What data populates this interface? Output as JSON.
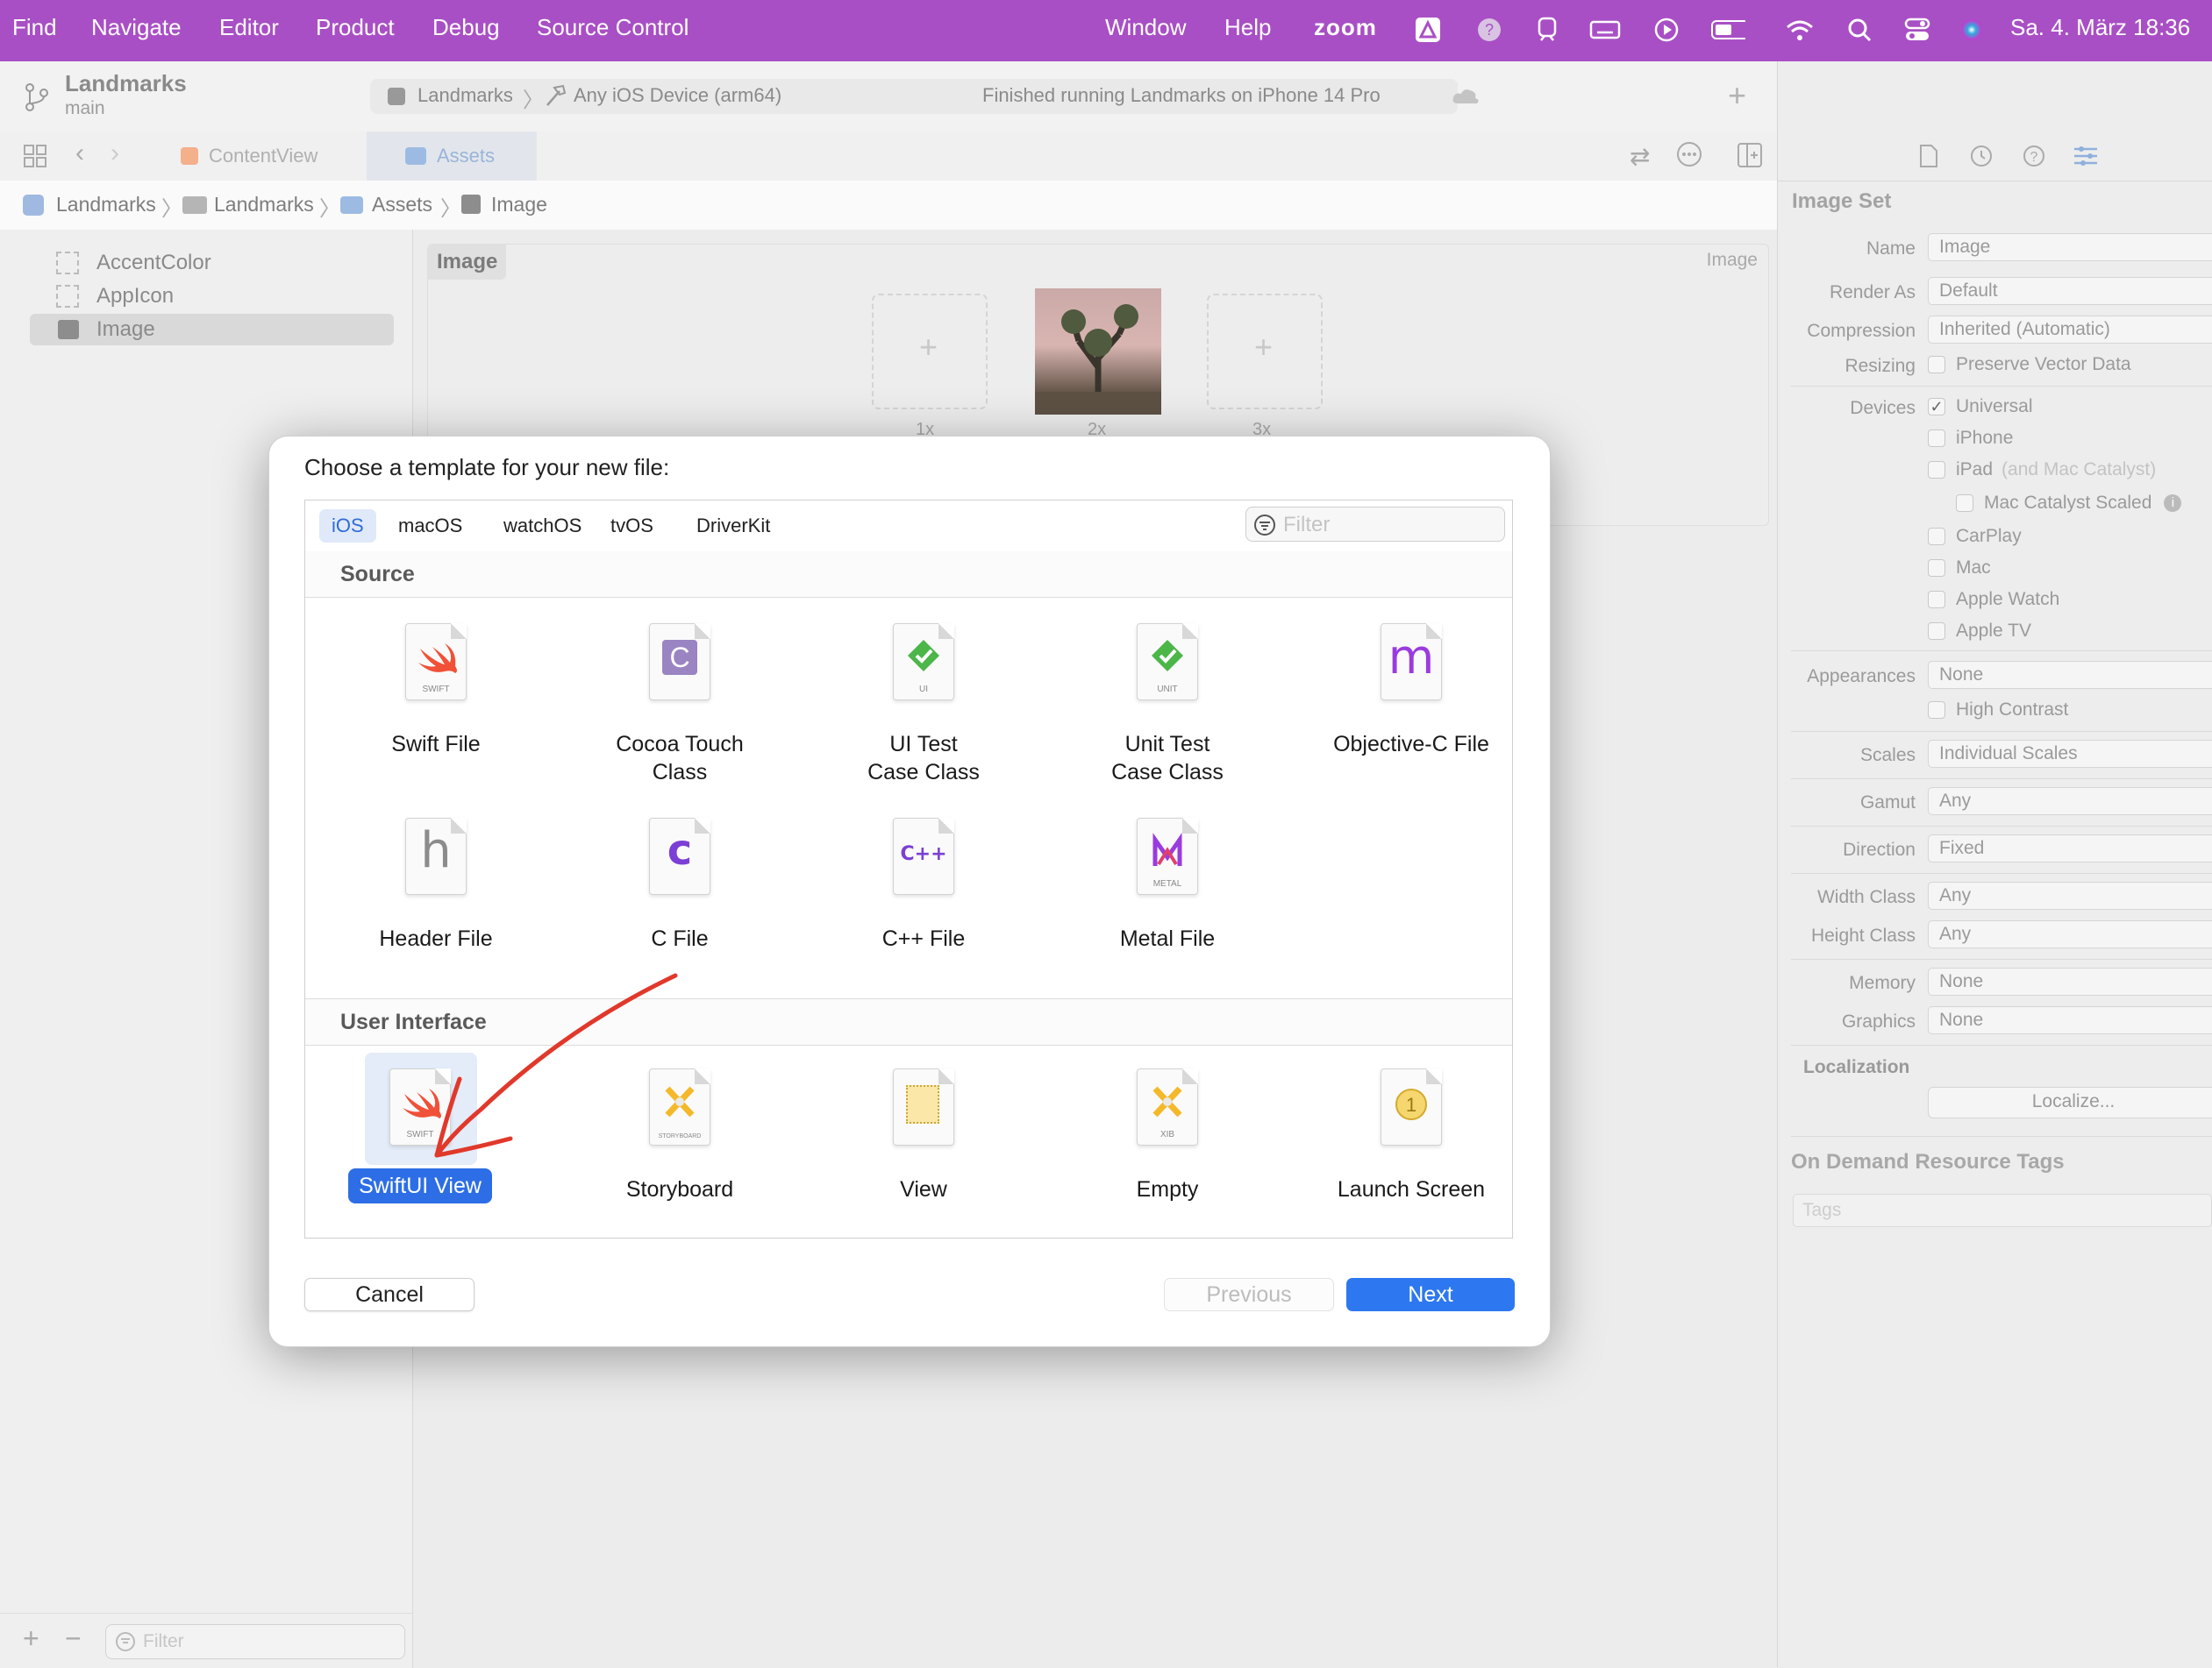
{
  "menubar": {
    "items": [
      "Find",
      "Navigate",
      "Editor",
      "Product",
      "Debug",
      "Source Control",
      "Window",
      "Help"
    ],
    "zoom": "zoom",
    "datetime": "Sa. 4. März  18:36"
  },
  "toolbar": {
    "project": "Landmarks",
    "branch": "main",
    "scheme": "Landmarks",
    "destination": "Any iOS Device (arm64)",
    "status": "Finished running Landmarks on iPhone 14 Pro"
  },
  "tabs": [
    "ContentView",
    "Assets"
  ],
  "breadcrumb": [
    "Landmarks",
    "Landmarks",
    "Assets",
    "Image"
  ],
  "navigator": {
    "items": [
      "AccentColor",
      "AppIcon",
      "Image"
    ],
    "filter_placeholder": "Filter"
  },
  "asset": {
    "title": "Image",
    "kind": "Image",
    "slots": [
      "1x",
      "2x",
      "3x"
    ]
  },
  "inspector": {
    "section": "Image Set",
    "rows": {
      "name_label": "Name",
      "name_value": "Image",
      "render_label": "Render As",
      "render_value": "Default",
      "compression_label": "Compression",
      "compression_value": "Inherited (Automatic)",
      "resizing_label": "Resizing",
      "resizing_value": "Preserve Vector Data",
      "devices_label": "Devices",
      "devices": [
        "Universal",
        "iPhone",
        "iPad",
        "Mac Catalyst Scaled",
        "CarPlay",
        "Mac",
        "Apple Watch",
        "Apple TV"
      ],
      "ipad_note": "(and Mac Catalyst)",
      "appearances_label": "Appearances",
      "appearances_value": "None",
      "high_contrast": "High Contrast",
      "scales_label": "Scales",
      "scales_value": "Individual Scales",
      "gamut_label": "Gamut",
      "gamut_value": "Any",
      "direction_label": "Direction",
      "direction_value": "Fixed",
      "width_label": "Width Class",
      "width_value": "Any",
      "height_label": "Height Class",
      "height_value": "Any",
      "memory_label": "Memory",
      "memory_value": "None",
      "graphics_label": "Graphics",
      "graphics_value": "None"
    },
    "localization": "Localization",
    "localize_button": "Localize...",
    "odr_title": "On Demand Resource Tags",
    "tags_placeholder": "Tags"
  },
  "dialog": {
    "title": "Choose a template for your new file:",
    "platforms": [
      "iOS",
      "macOS",
      "watchOS",
      "tvOS",
      "DriverKit"
    ],
    "selected_platform": "iOS",
    "filter_placeholder": "Filter",
    "sections": {
      "source": "Source",
      "ui": "User Interface"
    },
    "source_templates": [
      {
        "l1": "Swift File",
        "l2": "",
        "icon": "swift-icon",
        "cap": "SWIFT"
      },
      {
        "l1": "Cocoa Touch",
        "l2": "Class",
        "icon": "cocoa-touch-class-icon",
        "cap": ""
      },
      {
        "l1": "UI Test",
        "l2": "Case Class",
        "icon": "ui-test-icon",
        "cap": "UI"
      },
      {
        "l1": "Unit Test",
        "l2": "Case Class",
        "icon": "unit-test-icon",
        "cap": "UNIT"
      },
      {
        "l1": "Objective-C File",
        "l2": "",
        "icon": "objc-icon",
        "cap": ""
      },
      {
        "l1": "Header File",
        "l2": "",
        "icon": "header-icon",
        "cap": ""
      },
      {
        "l1": "C File",
        "l2": "",
        "icon": "c-file-icon",
        "cap": ""
      },
      {
        "l1": "C++ File",
        "l2": "",
        "icon": "cpp-file-icon",
        "cap": ""
      },
      {
        "l1": "Metal File",
        "l2": "",
        "icon": "metal-icon",
        "cap": "METAL"
      }
    ],
    "ui_templates": [
      {
        "l1": "SwiftUI View",
        "icon": "swift-icon",
        "cap": "SWIFT"
      },
      {
        "l1": "Storyboard",
        "icon": "storyboard-icon",
        "cap": "STORYBOARD"
      },
      {
        "l1": "View",
        "icon": "view-icon",
        "cap": ""
      },
      {
        "l1": "Empty",
        "icon": "xib-icon",
        "cap": "XIB"
      },
      {
        "l1": "Launch Screen",
        "icon": "launch-screen-icon",
        "cap": ""
      }
    ],
    "selected_template": "SwiftUI View",
    "buttons": {
      "cancel": "Cancel",
      "previous": "Previous",
      "next": "Next"
    },
    "accent": "#2d6ee6",
    "annotation_color": "#e0392b"
  }
}
